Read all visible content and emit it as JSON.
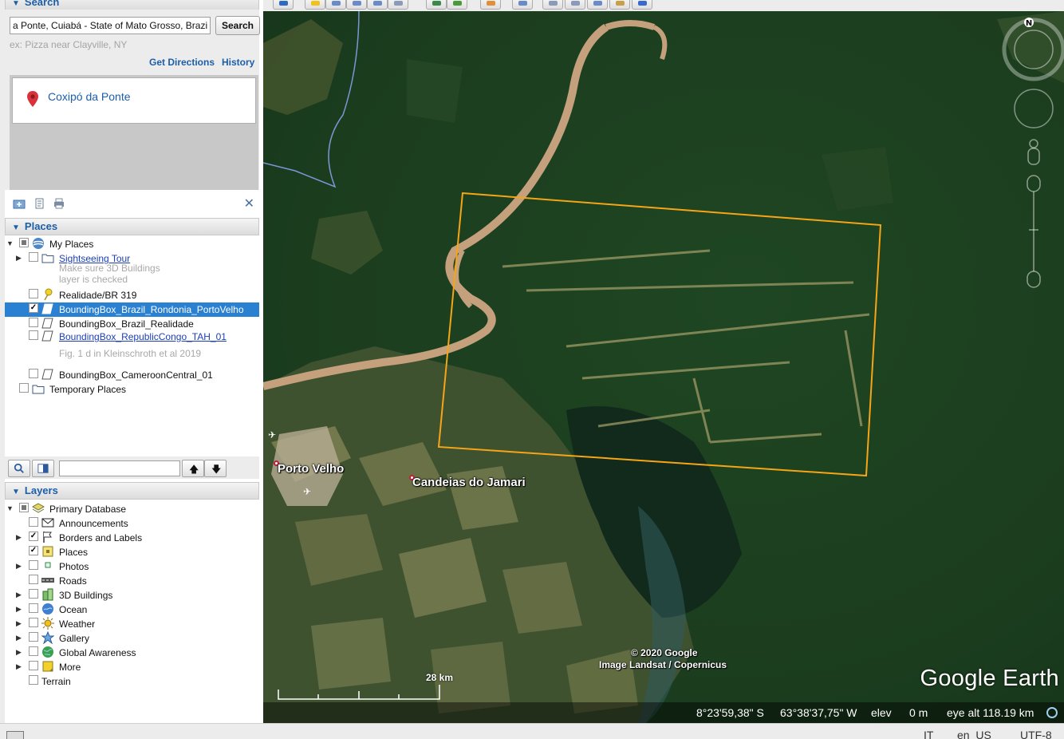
{
  "search": {
    "header": "Search",
    "input_value": "a Ponte, Cuiabá - State of Mato Grosso, Brazil",
    "button_label": "Search",
    "example": "ex: Pizza near Clayville, NY",
    "get_directions": "Get Directions",
    "history": "History",
    "result": "Coxipó da Ponte"
  },
  "places": {
    "header": "Places",
    "items": [
      {
        "label": "My Places",
        "checked": "mixed",
        "icon": "my-places-icon"
      },
      {
        "label": "Sightseeing Tour",
        "checked": false,
        "icon": "folder-icon",
        "link": true
      },
      {
        "label": "Make sure 3D Buildings",
        "desc": true
      },
      {
        "label": "layer is checked",
        "desc": true
      },
      {
        "label": "Realidade/BR 319",
        "checked": false,
        "icon": "pushpin-icon"
      },
      {
        "label": "BoundingBox_Brazil_Rondonia_PortoVelho",
        "checked": true,
        "icon": "polygon-icon",
        "selected": true
      },
      {
        "label": "BoundingBox_Brazil_Realidade",
        "checked": false,
        "icon": "polygon-icon"
      },
      {
        "label": "BoundingBox_RepublicCongo_TAH_01",
        "checked": false,
        "icon": "polygon-icon",
        "link": true
      },
      {
        "label": "Fig. 1 d in Kleinschroth et al 2019",
        "desc": true
      },
      {
        "label": "BoundingBox_CameroonCentral_01",
        "checked": false,
        "icon": "polygon-icon"
      },
      {
        "label": "Temporary Places",
        "checked": false,
        "icon": "folder-icon"
      }
    ]
  },
  "layers": {
    "header": "Layers",
    "items": [
      {
        "label": "Primary Database",
        "checked": "mixed",
        "icon": "database-icon"
      },
      {
        "label": "Announcements",
        "checked": false,
        "icon": "envelope-icon"
      },
      {
        "label": "Borders and Labels",
        "checked": true,
        "icon": "borders-icon"
      },
      {
        "label": "Places",
        "checked": true,
        "icon": "places-icon"
      },
      {
        "label": "Photos",
        "checked": false,
        "icon": "photos-icon"
      },
      {
        "label": "Roads",
        "checked": false,
        "icon": "roads-icon"
      },
      {
        "label": "3D Buildings",
        "checked": false,
        "icon": "buildings-icon"
      },
      {
        "label": "Ocean",
        "checked": false,
        "icon": "ocean-icon"
      },
      {
        "label": "Weather",
        "checked": false,
        "icon": "weather-icon"
      },
      {
        "label": "Gallery",
        "checked": false,
        "icon": "gallery-icon"
      },
      {
        "label": "Global Awareness",
        "checked": false,
        "icon": "globe-icon"
      },
      {
        "label": "More",
        "checked": false,
        "icon": "more-icon"
      },
      {
        "label": "Terrain",
        "checked": false
      }
    ]
  },
  "map": {
    "cities": [
      "Porto Velho",
      "Candeias do Jamari"
    ],
    "copyright": "© 2020 Google",
    "imagery": "Image Landsat / Copernicus",
    "brand": "Google Earth",
    "scale": "28 km",
    "compass": "N",
    "status": {
      "lat": "8°23'59,38\" S",
      "lon": "63°38'37,75\" W",
      "elev_label": "elev",
      "elev_value": "0 m",
      "eye_alt": "eye alt 118.19 km"
    },
    "polygon_color": "#f5a516"
  },
  "osbar": {
    "lang": "en_US",
    "encoding": "UTF-8",
    "cursor": "IT"
  }
}
